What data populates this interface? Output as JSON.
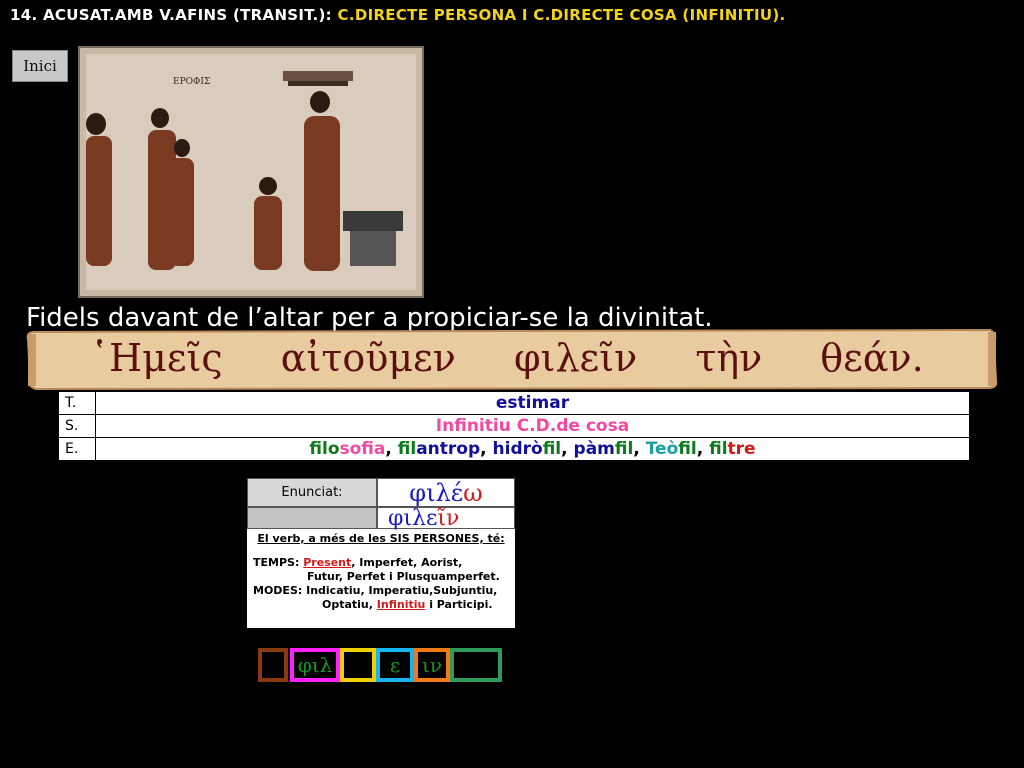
{
  "header": {
    "number": "14.",
    "part_white": "ACUSAT.AMB V.AFINS (TRANSIT.):",
    "part_yellow": "C.DIRECTE PERSONA I C.DIRECTE COSA (INFINITIU)."
  },
  "nav": {
    "inici_label": "Inici"
  },
  "caption": "Fidels davant de l’altar per a propiciar-se la divinitat.",
  "greek_sentence": [
    "῾Ημεῖς",
    "αἰτοῦμεν",
    "φιλεῖν",
    "τὴν",
    "θεάν."
  ],
  "tse": {
    "t_key": "T.",
    "t_val": "estimar",
    "s_key": "S.",
    "s_val": "Infinitiu C.D.de cosa",
    "e_key": "E.",
    "e_parts": [
      {
        "text": "filo",
        "c": "green"
      },
      {
        "text": "sofia",
        "c": "pink"
      },
      {
        "text": ", ",
        "c": "blk"
      },
      {
        "text": "fil",
        "c": "green"
      },
      {
        "text": "antrop",
        "c": "blue"
      },
      {
        "text": ", ",
        "c": "blk"
      },
      {
        "text": "hidrò",
        "c": "blue"
      },
      {
        "text": "fil",
        "c": "green"
      },
      {
        "text": ", ",
        "c": "blk"
      },
      {
        "text": "pàm",
        "c": "blue"
      },
      {
        "text": "fil",
        "c": "green"
      },
      {
        "text": ", ",
        "c": "blk"
      },
      {
        "text": "Teò",
        "c": "teal"
      },
      {
        "text": "fil",
        "c": "green"
      },
      {
        "text": ", ",
        "c": "blk"
      },
      {
        "text": "fil",
        "c": "green"
      },
      {
        "text": "tre",
        "c": "red"
      }
    ]
  },
  "enunciat": {
    "label": "Enunciat:",
    "value_stem": "φιλέ",
    "value_end": "ω",
    "inf_stem": "φιλε",
    "inf_end": "ῖν",
    "title": "El verb, a més de les SIS PERSONES, té:",
    "temps_label": "TEMPS:",
    "temps_present": "Present",
    "temps_rest1": ", Imperfet, Aorist,",
    "temps_rest2": "Futur, Perfet i Plusquamperfet.",
    "modes_label": "MODES:",
    "modes_rest1": "Indicatiu, Imperatiu,Subjuntiu,",
    "modes_optatiu": "Optatiu,",
    "modes_infinitiu": "Infinitiu",
    "modes_rest2": "i Participi."
  },
  "boxes": [
    {
      "text": "",
      "border": "#8a3a12"
    },
    {
      "text": "φιλ",
      "border": "#ff22ff"
    },
    {
      "text": "",
      "border": "#f0d000"
    },
    {
      "text": "ε",
      "border": "#18b4f0"
    },
    {
      "text": "ιν",
      "border": "#f07a18"
    },
    {
      "text": "",
      "border": "#2f9a5a"
    }
  ],
  "colors": {
    "header_yellow": "#f2d21a",
    "scroll": "#e9cba0",
    "greek_text": "#5b0f0f",
    "enunciat_red": "#d01a1a",
    "enunciat_green": "#119a22",
    "enunciat_blue": "#1a1ac0"
  }
}
